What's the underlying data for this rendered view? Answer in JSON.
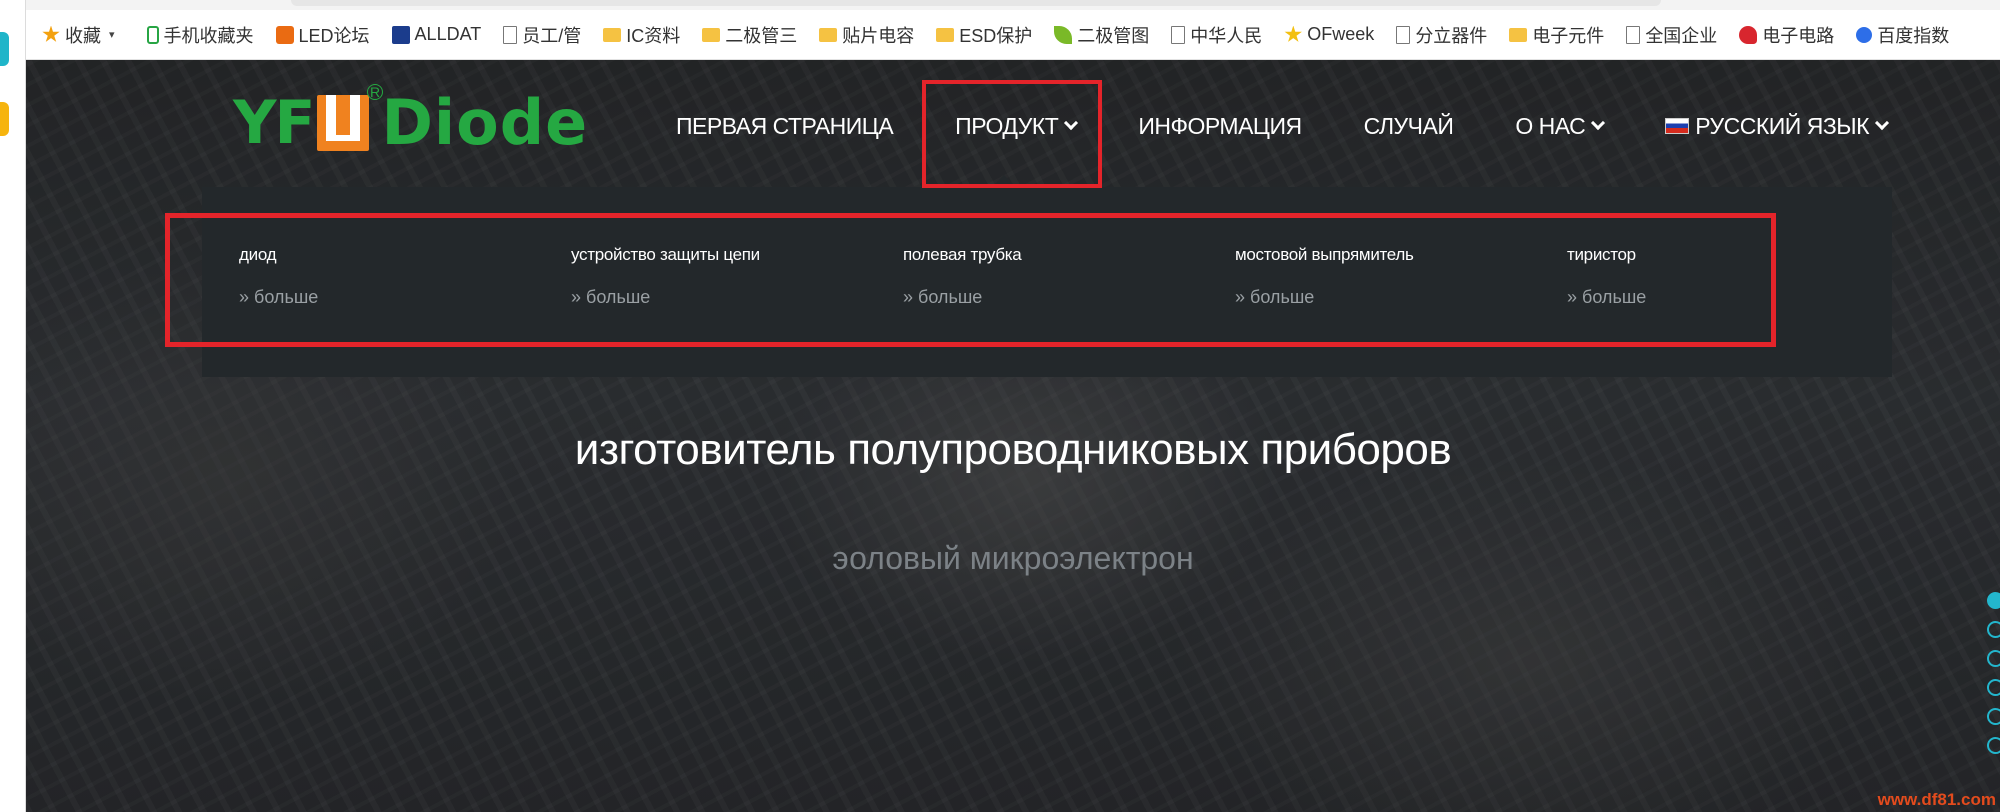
{
  "bookmarks": [
    {
      "label": "收藏",
      "icon": "star-icon"
    },
    {
      "label": "手机收藏夹",
      "icon": "phone-icon"
    },
    {
      "label": "LED论坛",
      "icon": "led-icon"
    },
    {
      "label": "ALLDAT",
      "icon": "pdf-icon"
    },
    {
      "label": "员工/管",
      "icon": "doc-icon"
    },
    {
      "label": "IC资料",
      "icon": "folder-icon"
    },
    {
      "label": "二极管三",
      "icon": "folder-icon"
    },
    {
      "label": "贴片电容",
      "icon": "folder-icon"
    },
    {
      "label": "ESD保护",
      "icon": "folder-icon"
    },
    {
      "label": "二极管图",
      "icon": "leaf-icon"
    },
    {
      "label": "中华人民",
      "icon": "doc-icon"
    },
    {
      "label": "OFweek",
      "icon": "star-icon"
    },
    {
      "label": "分立器件",
      "icon": "doc-icon"
    },
    {
      "label": "电子元件",
      "icon": "folder-icon"
    },
    {
      "label": "全国企业",
      "icon": "doc-icon"
    },
    {
      "label": "电子电路",
      "icon": "red-icon"
    },
    {
      "label": "百度指数",
      "icon": "paw-icon"
    }
  ],
  "logo": {
    "part1": "YF",
    "part2": "Diode",
    "reg": "R"
  },
  "nav": [
    {
      "label": "ПЕРВАЯ СТРАНИЦА",
      "dropdown": false
    },
    {
      "label": "ПРОДУКТ",
      "dropdown": true
    },
    {
      "label": "ИНФОРМАЦИЯ",
      "dropdown": false
    },
    {
      "label": "СЛУЧАЙ",
      "dropdown": false
    },
    {
      "label": "О НАС",
      "dropdown": true
    },
    {
      "label": "РУССКИЙ ЯЗЫК",
      "dropdown": true
    }
  ],
  "dropdown": [
    {
      "title": "диод",
      "more": "» больше"
    },
    {
      "title": "устройство защиты цепи",
      "more": "» больше"
    },
    {
      "title": "полевая трубка",
      "more": "» больше"
    },
    {
      "title": "мостовой выпрямитель",
      "more": "» больше"
    },
    {
      "title": "тиристор",
      "more": "» больше"
    }
  ],
  "hero": {
    "title": "изготовитель полупроводниковых приборов",
    "subtitle": "эоловый микроэлектрон"
  },
  "slider": {
    "count": 6,
    "active_index": 0
  },
  "watermark": "www.df81.com",
  "colors": {
    "brand_green": "#25a842",
    "brand_orange": "#f0821f",
    "highlight_red": "#e4242a",
    "accent_teal": "#23b6cd"
  }
}
